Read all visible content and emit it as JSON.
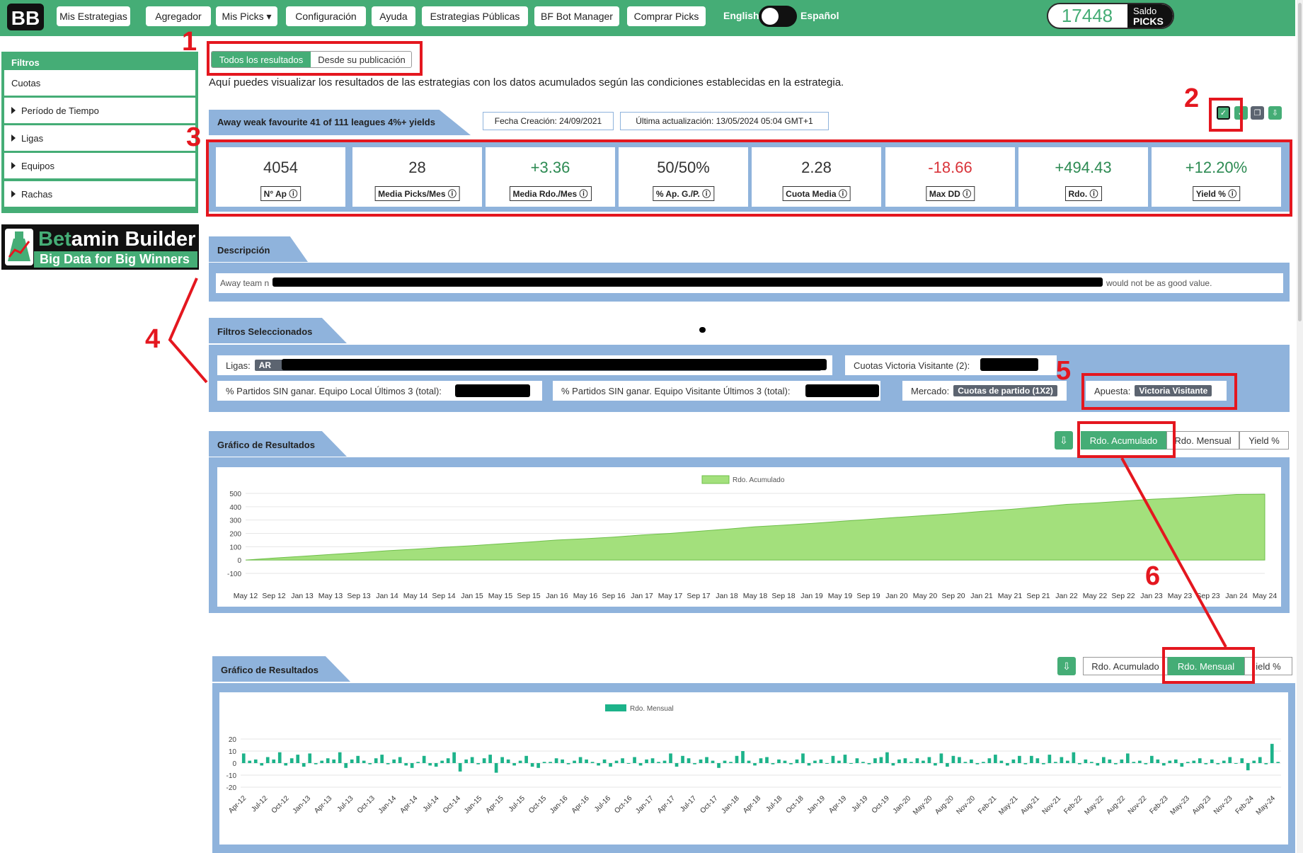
{
  "nav": {
    "logo_text": "BB",
    "items": [
      {
        "label": "Mis Estrategias"
      },
      {
        "label": "Agregador"
      },
      {
        "label": "Mis Picks ▾"
      },
      {
        "label": "Configuración"
      },
      {
        "label": "Ayuda"
      },
      {
        "label": "Estrategias Públicas"
      },
      {
        "label": "BF Bot Manager"
      },
      {
        "label": "Comprar Picks"
      }
    ],
    "lang_left": "English",
    "lang_right": "Español",
    "balance_value": "17448",
    "balance_label_1": "Saldo",
    "balance_label_2": "PICKS"
  },
  "sidebar": {
    "title": "Filtros",
    "items": [
      {
        "label": "Cuotas"
      },
      {
        "label": "Período de Tiempo"
      },
      {
        "label": "Ligas"
      },
      {
        "label": "Equipos"
      },
      {
        "label": "Rachas"
      }
    ],
    "brand_bet": "Bet",
    "brand_rest": "amin Builder",
    "brand_tagline": "Big Data for Big Winners"
  },
  "tabs": {
    "all": "Todos los resultados",
    "since_pub": "Desde su publicación"
  },
  "intro": "Aquí puedes visualizar los resultados de las estrategias con los datos acumulados según las condiciones establecidas en la estrategia.",
  "strategy": {
    "name": "Away weak favourite 41 of 111 leagues 4%+ yields",
    "created": "Fecha Creación: 24/09/2021",
    "updated": "Última actualización: 13/05/2024 05:04 GMT+1"
  },
  "stats": [
    {
      "value": "4054",
      "label": "N° Ap"
    },
    {
      "value": "28",
      "label": "Media Picks/Mes"
    },
    {
      "value": "+3.36",
      "label": "Media Rdo./Mes"
    },
    {
      "value": "50/50%",
      "label": "% Ap. G./P."
    },
    {
      "value": "2.28",
      "label": "Cuota Media"
    },
    {
      "value": "-18.66",
      "label": "Max DD"
    },
    {
      "value": "+494.43",
      "label": "Rdo."
    },
    {
      "value": "+12.20%",
      "label": "Yield %"
    }
  ],
  "description": {
    "title": "Descripción",
    "text_start": "Away team n",
    "text_end": "would not be as good value."
  },
  "selected_filters": {
    "title": "Filtros Seleccionados",
    "ligas_label": "Ligas:",
    "ligas_value": "AR",
    "cuotas_label": "Cuotas Victoria Visitante (2):",
    "local_label": "% Partidos SIN ganar. Equipo Local Últimos 3 (total):",
    "visit_label": "% Partidos SIN ganar. Equipo Visitante Últimos 3 (total):",
    "mercado_label": "Mercado:",
    "mercado_value": "Cuotas de partido (1X2)",
    "apuesta_label": "Apuesta:",
    "apuesta_value": "Victoria Visitante"
  },
  "chart1": {
    "title": "Gráfico de Resultados",
    "buttons": {
      "acum": "Rdo. Acumulado",
      "mensual": "Rdo. Mensual",
      "yield": "Yield %"
    }
  },
  "chart2": {
    "title": "Gráfico de Resultados",
    "buttons": {
      "acum": "Rdo. Acumulado",
      "mensual": "Rdo. Mensual",
      "yield": "ield %"
    }
  },
  "annotations": [
    "1",
    "2",
    "3",
    "4",
    "5",
    "6"
  ],
  "colors": {
    "accent": "#45ad76",
    "panel": "#8fb3dc",
    "area": "#a3e07c",
    "bars": "#1db38a",
    "annotation": "#e4171f",
    "negative": "#d9343a"
  },
  "chart_data": [
    {
      "type": "area",
      "series": [
        {
          "name": "Rdo. Acumulado",
          "values": [
            0,
            15,
            28,
            42,
            55,
            70,
            82,
            96,
            108,
            122,
            135,
            150,
            160,
            172,
            188,
            200,
            216,
            232,
            250,
            262,
            275,
            290,
            305,
            320,
            334,
            348,
            365,
            380,
            398,
            418,
            428,
            442,
            456,
            466,
            478,
            492,
            494
          ]
        }
      ],
      "x_ticks": [
        "May 12",
        "Sep 12",
        "Jan 13",
        "May 13",
        "Sep 13",
        "Jan 14",
        "May 14",
        "Sep 14",
        "Jan 15",
        "May 15",
        "Sep 15",
        "Jan 16",
        "May 16",
        "Sep 16",
        "Jan 17",
        "May 17",
        "Sep 17",
        "Jan 18",
        "May 18",
        "Sep 18",
        "Jan 19",
        "May 19",
        "Sep 19",
        "Jan 20",
        "May 20",
        "Sep 20",
        "Jan 21",
        "May 21",
        "Sep 21",
        "Jan 22",
        "May 22",
        "Sep 22",
        "Jan 23",
        "May 23",
        "Sep 23",
        "Jan 24",
        "May 24"
      ],
      "y_ticks": [
        500,
        400,
        300,
        200,
        100,
        0,
        -100
      ],
      "ylim": [
        -100,
        500
      ],
      "grid": true,
      "legend": "top-center"
    },
    {
      "type": "bar",
      "series": [
        {
          "name": "Rdo. Mensual",
          "values": [
            8,
            2,
            3,
            -2,
            5,
            3,
            9,
            -2,
            4,
            7,
            -3,
            8,
            -1,
            2,
            4,
            3,
            9,
            -4,
            3,
            6,
            2,
            -1,
            4,
            7,
            -1,
            3,
            5,
            -2,
            -4,
            1,
            6,
            -2,
            -3,
            2,
            4,
            9,
            -7,
            3,
            5,
            -1,
            4,
            7,
            -8,
            5,
            3,
            -2,
            2,
            6,
            -3,
            -4,
            1,
            1,
            4,
            3,
            -1,
            2,
            5,
            3,
            1,
            -2,
            3,
            -3,
            2,
            4,
            0,
            5,
            -2,
            3,
            4,
            1,
            2,
            8,
            -3,
            6,
            4,
            -1,
            3,
            5,
            2,
            -4,
            2,
            1,
            6,
            10,
            2,
            -2,
            4,
            5,
            -1,
            3,
            2,
            -1,
            3,
            8,
            -2,
            2,
            3,
            0,
            6,
            2,
            7,
            0,
            4,
            1,
            -1,
            4,
            5,
            9,
            -2,
            3,
            4,
            1,
            4,
            2,
            5,
            -2,
            8,
            -3,
            6,
            5,
            1,
            3,
            -1,
            1,
            4,
            7,
            2,
            -2,
            3,
            6,
            -1,
            6,
            4,
            -1,
            7,
            1,
            5,
            2,
            9,
            -1,
            3,
            1,
            -2,
            5,
            3,
            -1,
            3,
            8,
            1,
            2,
            -1,
            6,
            3,
            -2,
            2,
            3,
            -3,
            1,
            2,
            4,
            -1,
            3,
            -1,
            2,
            5,
            0,
            4,
            -6,
            2,
            5,
            -1,
            16,
            1
          ]
        }
      ],
      "x_ticks": [
        "Apr-12",
        "Jul-12",
        "Oct-12",
        "Jan-13",
        "Apr-13",
        "Jul-13",
        "Oct-13",
        "Jan-14",
        "Apr-14",
        "Jul-14",
        "Oct-14",
        "Jan-15",
        "Apr-15",
        "Jul-15",
        "Oct-15",
        "Jan-16",
        "Apr-16",
        "Jul-16",
        "Oct-16",
        "Jan-17",
        "Apr-17",
        "Jul-17",
        "Oct-17",
        "Jan-18",
        "Apr-18",
        "Jul-18",
        "Oct-18",
        "Jan-19",
        "Apr-19",
        "Jul-19",
        "Oct-19",
        "Jan-20",
        "May-20",
        "Aug-20",
        "Nov-20",
        "Feb-21",
        "May-21",
        "Aug-21",
        "Nov-21",
        "Feb-22",
        "May-22",
        "Aug-22",
        "Nov-22",
        "Feb-23",
        "May-23",
        "Aug-23",
        "Nov-23",
        "Feb-24",
        "May-24"
      ],
      "y_ticks": [
        20,
        10,
        0,
        -10,
        -20
      ],
      "ylim": [
        -20,
        20
      ],
      "grid": true,
      "legend": "top-center"
    }
  ]
}
